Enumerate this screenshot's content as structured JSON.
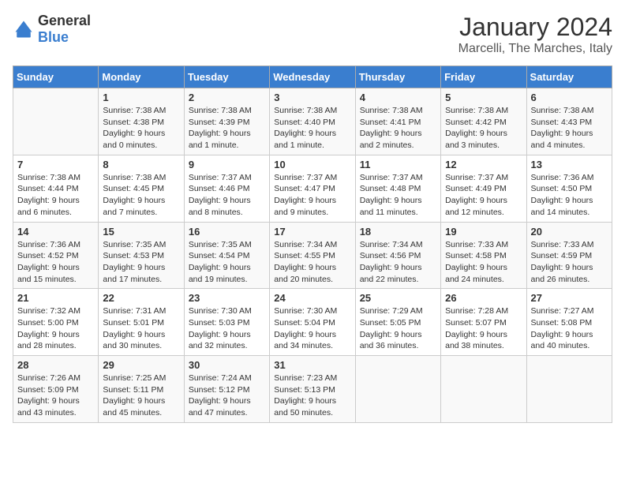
{
  "header": {
    "logo_general": "General",
    "logo_blue": "Blue",
    "month": "January 2024",
    "location": "Marcelli, The Marches, Italy"
  },
  "weekdays": [
    "Sunday",
    "Monday",
    "Tuesday",
    "Wednesday",
    "Thursday",
    "Friday",
    "Saturday"
  ],
  "weeks": [
    [
      {
        "day": "",
        "sunrise": "",
        "sunset": "",
        "daylight": ""
      },
      {
        "day": "1",
        "sunrise": "Sunrise: 7:38 AM",
        "sunset": "Sunset: 4:38 PM",
        "daylight": "Daylight: 9 hours and 0 minutes."
      },
      {
        "day": "2",
        "sunrise": "Sunrise: 7:38 AM",
        "sunset": "Sunset: 4:39 PM",
        "daylight": "Daylight: 9 hours and 1 minute."
      },
      {
        "day": "3",
        "sunrise": "Sunrise: 7:38 AM",
        "sunset": "Sunset: 4:40 PM",
        "daylight": "Daylight: 9 hours and 1 minute."
      },
      {
        "day": "4",
        "sunrise": "Sunrise: 7:38 AM",
        "sunset": "Sunset: 4:41 PM",
        "daylight": "Daylight: 9 hours and 2 minutes."
      },
      {
        "day": "5",
        "sunrise": "Sunrise: 7:38 AM",
        "sunset": "Sunset: 4:42 PM",
        "daylight": "Daylight: 9 hours and 3 minutes."
      },
      {
        "day": "6",
        "sunrise": "Sunrise: 7:38 AM",
        "sunset": "Sunset: 4:43 PM",
        "daylight": "Daylight: 9 hours and 4 minutes."
      }
    ],
    [
      {
        "day": "7",
        "sunrise": "Sunrise: 7:38 AM",
        "sunset": "Sunset: 4:44 PM",
        "daylight": "Daylight: 9 hours and 6 minutes."
      },
      {
        "day": "8",
        "sunrise": "Sunrise: 7:38 AM",
        "sunset": "Sunset: 4:45 PM",
        "daylight": "Daylight: 9 hours and 7 minutes."
      },
      {
        "day": "9",
        "sunrise": "Sunrise: 7:37 AM",
        "sunset": "Sunset: 4:46 PM",
        "daylight": "Daylight: 9 hours and 8 minutes."
      },
      {
        "day": "10",
        "sunrise": "Sunrise: 7:37 AM",
        "sunset": "Sunset: 4:47 PM",
        "daylight": "Daylight: 9 hours and 9 minutes."
      },
      {
        "day": "11",
        "sunrise": "Sunrise: 7:37 AM",
        "sunset": "Sunset: 4:48 PM",
        "daylight": "Daylight: 9 hours and 11 minutes."
      },
      {
        "day": "12",
        "sunrise": "Sunrise: 7:37 AM",
        "sunset": "Sunset: 4:49 PM",
        "daylight": "Daylight: 9 hours and 12 minutes."
      },
      {
        "day": "13",
        "sunrise": "Sunrise: 7:36 AM",
        "sunset": "Sunset: 4:50 PM",
        "daylight": "Daylight: 9 hours and 14 minutes."
      }
    ],
    [
      {
        "day": "14",
        "sunrise": "Sunrise: 7:36 AM",
        "sunset": "Sunset: 4:52 PM",
        "daylight": "Daylight: 9 hours and 15 minutes."
      },
      {
        "day": "15",
        "sunrise": "Sunrise: 7:35 AM",
        "sunset": "Sunset: 4:53 PM",
        "daylight": "Daylight: 9 hours and 17 minutes."
      },
      {
        "day": "16",
        "sunrise": "Sunrise: 7:35 AM",
        "sunset": "Sunset: 4:54 PM",
        "daylight": "Daylight: 9 hours and 19 minutes."
      },
      {
        "day": "17",
        "sunrise": "Sunrise: 7:34 AM",
        "sunset": "Sunset: 4:55 PM",
        "daylight": "Daylight: 9 hours and 20 minutes."
      },
      {
        "day": "18",
        "sunrise": "Sunrise: 7:34 AM",
        "sunset": "Sunset: 4:56 PM",
        "daylight": "Daylight: 9 hours and 22 minutes."
      },
      {
        "day": "19",
        "sunrise": "Sunrise: 7:33 AM",
        "sunset": "Sunset: 4:58 PM",
        "daylight": "Daylight: 9 hours and 24 minutes."
      },
      {
        "day": "20",
        "sunrise": "Sunrise: 7:33 AM",
        "sunset": "Sunset: 4:59 PM",
        "daylight": "Daylight: 9 hours and 26 minutes."
      }
    ],
    [
      {
        "day": "21",
        "sunrise": "Sunrise: 7:32 AM",
        "sunset": "Sunset: 5:00 PM",
        "daylight": "Daylight: 9 hours and 28 minutes."
      },
      {
        "day": "22",
        "sunrise": "Sunrise: 7:31 AM",
        "sunset": "Sunset: 5:01 PM",
        "daylight": "Daylight: 9 hours and 30 minutes."
      },
      {
        "day": "23",
        "sunrise": "Sunrise: 7:30 AM",
        "sunset": "Sunset: 5:03 PM",
        "daylight": "Daylight: 9 hours and 32 minutes."
      },
      {
        "day": "24",
        "sunrise": "Sunrise: 7:30 AM",
        "sunset": "Sunset: 5:04 PM",
        "daylight": "Daylight: 9 hours and 34 minutes."
      },
      {
        "day": "25",
        "sunrise": "Sunrise: 7:29 AM",
        "sunset": "Sunset: 5:05 PM",
        "daylight": "Daylight: 9 hours and 36 minutes."
      },
      {
        "day": "26",
        "sunrise": "Sunrise: 7:28 AM",
        "sunset": "Sunset: 5:07 PM",
        "daylight": "Daylight: 9 hours and 38 minutes."
      },
      {
        "day": "27",
        "sunrise": "Sunrise: 7:27 AM",
        "sunset": "Sunset: 5:08 PM",
        "daylight": "Daylight: 9 hours and 40 minutes."
      }
    ],
    [
      {
        "day": "28",
        "sunrise": "Sunrise: 7:26 AM",
        "sunset": "Sunset: 5:09 PM",
        "daylight": "Daylight: 9 hours and 43 minutes."
      },
      {
        "day": "29",
        "sunrise": "Sunrise: 7:25 AM",
        "sunset": "Sunset: 5:11 PM",
        "daylight": "Daylight: 9 hours and 45 minutes."
      },
      {
        "day": "30",
        "sunrise": "Sunrise: 7:24 AM",
        "sunset": "Sunset: 5:12 PM",
        "daylight": "Daylight: 9 hours and 47 minutes."
      },
      {
        "day": "31",
        "sunrise": "Sunrise: 7:23 AM",
        "sunset": "Sunset: 5:13 PM",
        "daylight": "Daylight: 9 hours and 50 minutes."
      },
      {
        "day": "",
        "sunrise": "",
        "sunset": "",
        "daylight": ""
      },
      {
        "day": "",
        "sunrise": "",
        "sunset": "",
        "daylight": ""
      },
      {
        "day": "",
        "sunrise": "",
        "sunset": "",
        "daylight": ""
      }
    ]
  ]
}
